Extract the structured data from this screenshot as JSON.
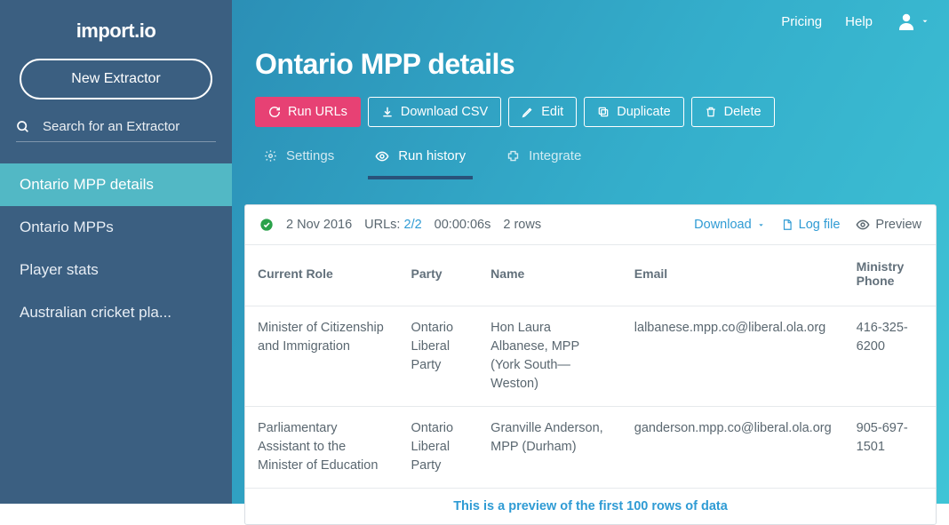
{
  "brand": "import.io",
  "sidebar": {
    "new_extractor_label": "New Extractor",
    "search_placeholder": "Search for an Extractor",
    "items": [
      {
        "label": "Ontario MPP details",
        "active": true
      },
      {
        "label": "Ontario MPPs",
        "active": false
      },
      {
        "label": "Player stats",
        "active": false
      },
      {
        "label": "Australian cricket pla...",
        "active": false
      }
    ]
  },
  "topbar": {
    "pricing": "Pricing",
    "help": "Help"
  },
  "page": {
    "title": "Ontario MPP details"
  },
  "actions": {
    "run_urls": "Run URLs",
    "download_csv": "Download CSV",
    "edit": "Edit",
    "duplicate": "Duplicate",
    "delete": "Delete"
  },
  "tabs": {
    "settings": "Settings",
    "run_history": "Run history",
    "integrate": "Integrate"
  },
  "run": {
    "date": "2 Nov 2016",
    "urls_label": "URLs:",
    "urls_value": "2/2",
    "elapsed": "00:00:06s",
    "rows": "2 rows",
    "download": "Download",
    "log_file": "Log file",
    "preview": "Preview"
  },
  "table": {
    "columns": [
      "Current Role",
      "Party",
      "Name",
      "Email",
      "Ministry Phone"
    ],
    "rows": [
      {
        "role": "Minister of Citizenship and Immigration",
        "party": "Ontario Liberal Party",
        "name": "Hon Laura Albanese, MPP (York South—Weston)",
        "email": "lalbanese.mpp.co@liberal.ola.org",
        "phone": "416-325-6200"
      },
      {
        "role": "Parliamentary Assistant to the Minister of Education",
        "party": "Ontario Liberal Party",
        "name": "Granville Anderson, MPP (Durham)",
        "email": "ganderson.mpp.co@liberal.ola.org",
        "phone": "905-697-1501"
      }
    ]
  },
  "preview_message": "This is a preview of the first 100 rows of data"
}
